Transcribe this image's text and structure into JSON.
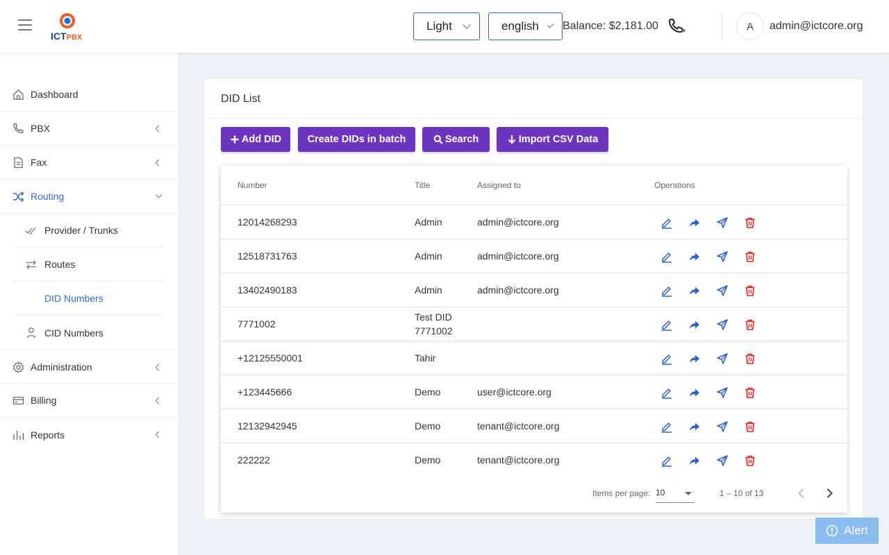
{
  "header": {
    "logo_text": "ICT",
    "logo_pbx": "PBX",
    "theme": "Light",
    "language": "english",
    "balance": "Balance: $2,181.00",
    "avatar_initial": "A",
    "user_email": "admin@ictcore.org"
  },
  "sidebar": {
    "dashboard": "Dashboard",
    "pbx": "PBX",
    "fax": "Fax",
    "routing": "Routing",
    "provider_trunks": "Provider / Trunks",
    "routes": "Routes",
    "did_numbers": "DID Numbers",
    "cid_numbers": "CID Numbers",
    "administration": "Administration",
    "billing": "Billing",
    "reports": "Reports"
  },
  "card": {
    "title": "DID List",
    "buttons": {
      "add": "Add DID",
      "batch": "Create DIDs in batch",
      "search": "Search",
      "import": "Import CSV Data"
    }
  },
  "table": {
    "headers": {
      "number": "Number",
      "title": "Title",
      "assigned": "Assigned to",
      "operations": "Operations"
    },
    "rows": [
      {
        "number": "12014268293",
        "title": "Admin",
        "assigned": "admin@ictcore.org"
      },
      {
        "number": "12518731763",
        "title": "Admin",
        "assigned": "admin@ictcore.org"
      },
      {
        "number": "13402490183",
        "title": "Admin",
        "assigned": "admin@ictcore.org"
      },
      {
        "number": "7771002",
        "title": "Test DID 7771002",
        "assigned": ""
      },
      {
        "number": "+12125550001",
        "title": "Tahir",
        "assigned": ""
      },
      {
        "number": "+123445666",
        "title": "Demo",
        "assigned": "user@ictcore.org"
      },
      {
        "number": "12132942945",
        "title": "Demo",
        "assigned": "tenant@ictcore.org"
      },
      {
        "number": "222222",
        "title": "Demo",
        "assigned": "tenant@ictcore.org"
      }
    ]
  },
  "paginator": {
    "label": "Items per page:",
    "page_size": "10",
    "range": "1 – 10 of 13"
  },
  "alert": {
    "label": "Alert"
  },
  "colors": {
    "primary_button": "#6b35c0",
    "active_link": "#3a64d8",
    "action_icon": "#2f5fd6",
    "delete_icon": "#e02020",
    "alert_button": "#8bbcf0"
  },
  "icons": {
    "row_operations": [
      "edit-icon",
      "forward-icon",
      "send-icon",
      "delete-icon"
    ]
  }
}
